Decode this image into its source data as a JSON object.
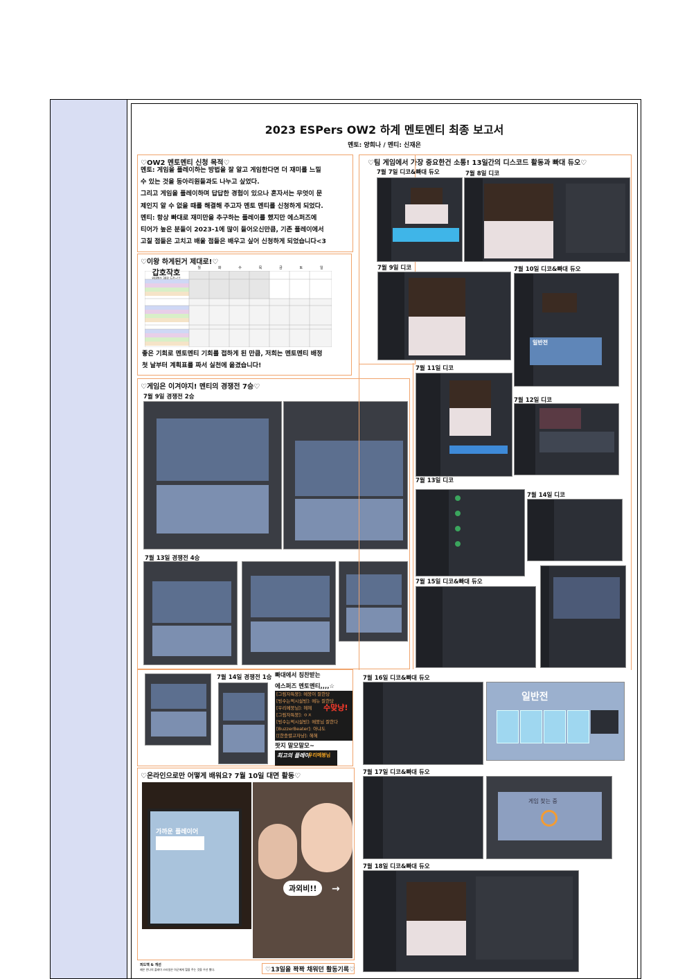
{
  "report": {
    "title": "2023 ESPers OW2 하계 멘토멘티 최종 보고서",
    "subtitle": "멘토: 양희나 / 멘티: 신재은"
  },
  "purpose": {
    "heading": "♡OW2 멘토멘티 신청 목적♡",
    "lines": [
      "멘토: 게임을 플레이하는 방법을 잘 알고 게임한다면 더 재미를 느낄",
      "수 있는 것을 동아리원들과도 나누고 싶었다.",
      "그리고 게임을 플레이하며 답답한 경험이 있으나 혼자서는 무엇이 문",
      "제인지 알 수 없을 때를 해결해 주고자 멘토 멘티를 신청하게 되었다.",
      "멘티: 항상 빠대로 재미만을 추구하는 플레이를 했지만 에스퍼즈에",
      "티어가 높은 분들이 2023-1에 많이 들어오신만큼, 기존 플레이에서",
      "고칠 점들은 고치고 배울 점들은 배우고 싶어 신청하게 되었습니다<3"
    ]
  },
  "plan": {
    "heading": "♡이왕 하게된거 제대로!♡",
    "schedule_title": "갑호작호",
    "schedule_sub": "위대했수 30장 도전~!!!",
    "days": [
      "월",
      "화",
      "수",
      "목",
      "금",
      "토",
      "일"
    ],
    "lines": [
      "좋은 기회로 멘토멘티 기회를 접하게 된 만큼, 저희는 멘토멘티 배정",
      "첫 날부터 계획표를 짜서 실천에 옮겼습니다!"
    ]
  },
  "competitive": {
    "heading": "♡게임은 이겨야지! 멘티의 경쟁전 7승♡",
    "cap1": "7월 9일 경쟁전 2승",
    "cap2": "7월 13일 경쟁전 4승",
    "cap3": "7월 14일 경쟁전 1승"
  },
  "praise": {
    "heading_1": "빠대에서 칭찬받는",
    "heading_2": "에스퍼즈 멘토멘티,,,,☆",
    "chat": [
      "[그림자특붕]: 메붕이 잘한당",
      "[빙수는먹시설빙]: 메뉴 잘한당",
      "[우리메붕님]: 헤헤",
      "[그림자특붕]: ㅇㅈ",
      "[빙수는먹시설빙]: 메붕님 잘한다",
      "[BuzzerBeater]: 아냐도",
      "[[한충렬고자냥]: 헤헤"
    ],
    "sticker": "수맞냥!",
    "caption": "팟지 말모말모~",
    "play_text": "최고의 플레이",
    "play_name": "우리메붕님"
  },
  "offline": {
    "heading": "♡온라인으로만 어떻게 배워요? 7월 10일 대면 활동♡",
    "monitor_text": "가까운 플레이어",
    "bubble": "과외비!!"
  },
  "bottom": {
    "feedback": "피드백 & 개선",
    "feedback_text": "제은 안나의 플레이 스타일은 아군에게 힐을 주는 것을 우선 했다.",
    "records": "♡13일을 꽉꽉 채워던 활동기록♡"
  },
  "discord": {
    "heading": "♡팀 게임에서 가장 중요한건 소통! 13일간의 디스코드 활동과 빠대 듀오♡",
    "captions": [
      "7월 7일 디코&빠대 듀오",
      "7월 8일 디코",
      "7월 9일 디코",
      "7월 10일 디코&빠대 듀오",
      "7월 11일 디코",
      "7월 12일 디코",
      "7월 13일 디코",
      "7월 14일 디코",
      "7월 15일 디코&빠대 듀오",
      "7월 16일 디코&빠대 듀오",
      "7월 17일 디코&빠대 듀오",
      "7월 18일 디코&빠대 듀오"
    ],
    "game_mode": "일반전",
    "searching": "게임 찾는 중"
  }
}
